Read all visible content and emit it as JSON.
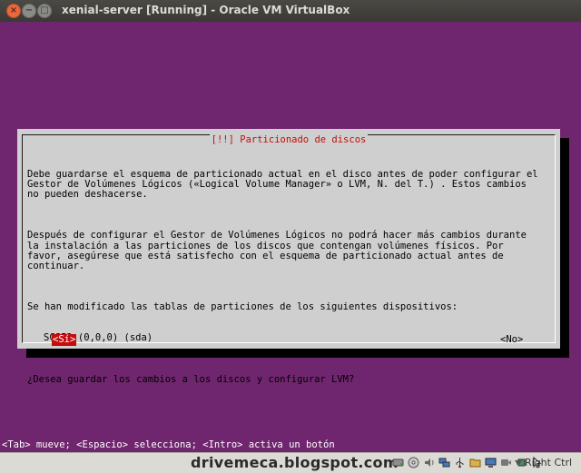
{
  "window": {
    "title": "xenial-server [Running] - Oracle VM VirtualBox"
  },
  "dialog": {
    "title": "[!!] Particionado de discos",
    "paragraphs": [
      "Debe guardarse el esquema de particionado actual en el disco antes de poder configurar el\nGestor de Volúmenes Lógicos («Logical Volume Manager» o LVM, N. del T.) . Estos cambios\nno pueden deshacerse.",
      "Después de configurar el Gestor de Volúmenes Lógicos no podrá hacer más cambios durante\nla instalación a las particiones de los discos que contengan volúmenes físicos. Por\nfavor, asegúrese que está satisfecho con el esquema de particionado actual antes de\ncontinuar.",
      "Se han modificado las tablas de particiones de los siguientes dispositivos:"
    ],
    "device": "SCSI3 (0,0,0) (sda)",
    "question": "¿Desea guardar los cambios a los discos y configurar LVM?",
    "yes_label": "<Sí>",
    "no_label": "<No>"
  },
  "hint_bar": "<Tab> mueve; <Espacio> selecciona; <Intro> activa un botón",
  "statusbar": {
    "watermark": "drivemeca.blogspot.com",
    "host_key": "Right Ctrl",
    "icons": [
      "hard-disk-icon",
      "optical-drive-icon",
      "audio-icon",
      "network-icon",
      "usb-icon",
      "shared-folder-icon",
      "display-icon",
      "video-capture-icon",
      "cpu-icon",
      "mouse-integration-icon"
    ]
  },
  "colors": {
    "guest_background": "#70266e",
    "dialog_background": "#cfcfcf",
    "accent_red": "#c40d0d"
  }
}
